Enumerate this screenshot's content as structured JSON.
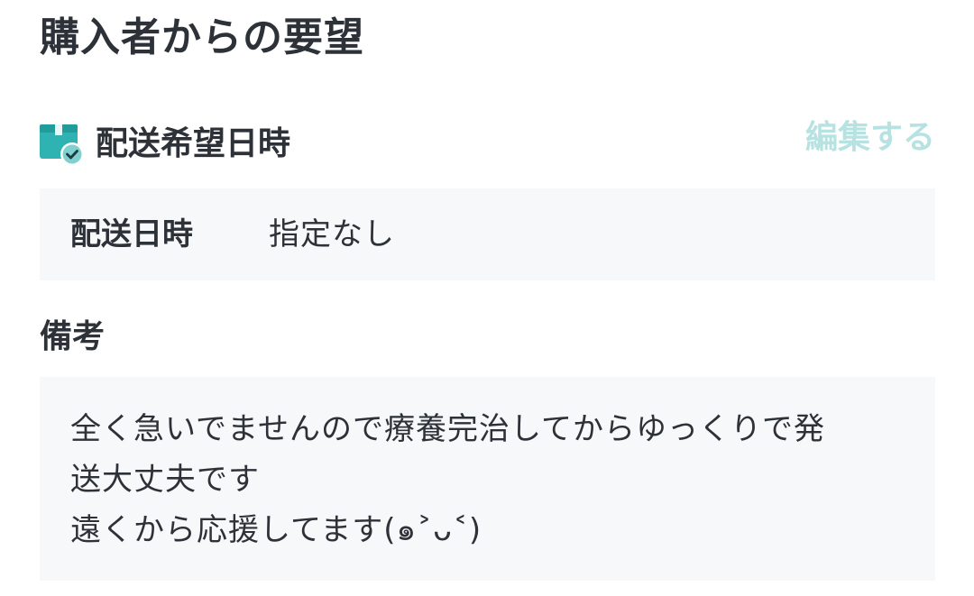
{
  "page_title": "購入者からの要望",
  "delivery_section": {
    "icon": "package-clock-icon",
    "title": "配送希望日時",
    "edit_label": "編集する",
    "date_label": "配送日時",
    "date_value": "指定なし"
  },
  "notes_section": {
    "title": "備考",
    "lines": [
      "全く急いでませんので療養完治してからゆっくりで発",
      "送大丈夫です",
      "遠くから応援してます(๑˃ᴗ˂)"
    ]
  },
  "colors": {
    "text": "#2d3138",
    "accent_disabled": "#b7e2e2",
    "icon_teal": "#2fb3b2",
    "panel_bg": "#f7f8fa"
  }
}
